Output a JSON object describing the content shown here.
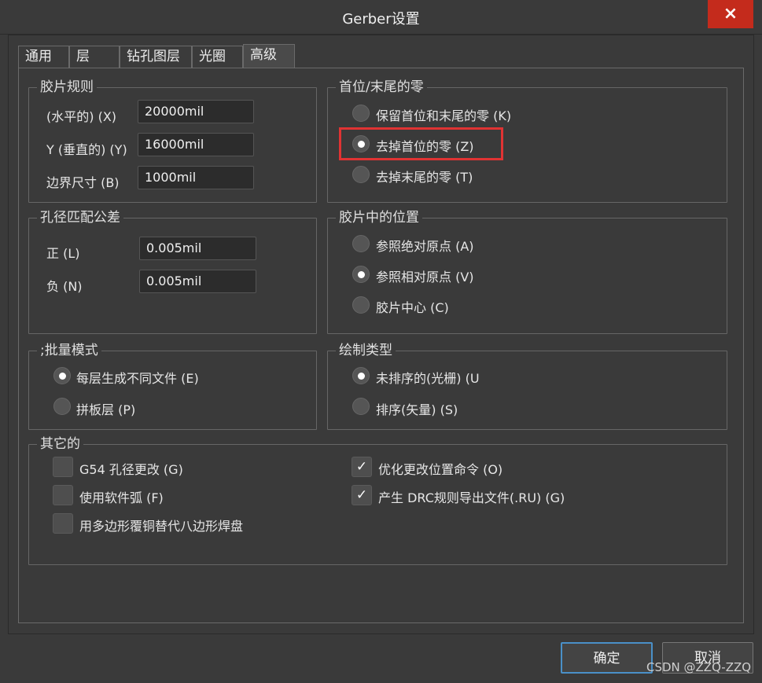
{
  "window": {
    "title": "Gerber设置",
    "close_icon": "×"
  },
  "tabs": [
    {
      "label": "通用"
    },
    {
      "label": "层"
    },
    {
      "label": "钻孔图层"
    },
    {
      "label": "光圈"
    },
    {
      "label": "高级"
    }
  ],
  "film_rules": {
    "title": "胶片规则",
    "rows": [
      {
        "label": "(水平的) (X)",
        "value": "20000mil"
      },
      {
        "label": "Y (垂直的) (Y)",
        "value": "16000mil"
      },
      {
        "label": "边界尺寸 (B)",
        "value": "1000mil"
      }
    ]
  },
  "zeros": {
    "title": "首位/末尾的零",
    "options": [
      {
        "label": "保留首位和末尾的零 (K)",
        "checked": false
      },
      {
        "label": "去掉首位的零 (Z)",
        "checked": true
      },
      {
        "label": "去掉末尾的零 (T)",
        "checked": false
      }
    ]
  },
  "aperture_tolerance": {
    "title": "孔径匹配公差",
    "rows": [
      {
        "label": "正 (L)",
        "value": "0.005mil"
      },
      {
        "label": "负 (N)",
        "value": "0.005mil"
      }
    ]
  },
  "film_position": {
    "title": "胶片中的位置",
    "options": [
      {
        "label": "参照绝对原点 (A)",
        "checked": false
      },
      {
        "label": "参照相对原点 (V)",
        "checked": true
      },
      {
        "label": "胶片中心 (C)",
        "checked": false
      }
    ]
  },
  "batch_mode": {
    "title": ";批量模式",
    "options": [
      {
        "label": "每层生成不同文件 (E)",
        "checked": true
      },
      {
        "label": "拼板层 (P)",
        "checked": false
      }
    ]
  },
  "plot_type": {
    "title": "绘制类型",
    "options": [
      {
        "label": "未排序的(光栅) (U",
        "checked": true
      },
      {
        "label": "排序(矢量) (S)",
        "checked": false
      }
    ]
  },
  "other": {
    "title": "其它的",
    "checks": [
      {
        "label": "G54 孔径更改 (G)",
        "checked": false
      },
      {
        "label": "使用软件弧 (F)",
        "checked": false
      },
      {
        "label": "用多边形覆铜替代八边形焊盘",
        "checked": false
      },
      {
        "label": "优化更改位置命令 (O)",
        "checked": true
      },
      {
        "label": "产生 DRC规则导出文件(.RU) (G)",
        "checked": true
      }
    ],
    "check_glyph": "✓"
  },
  "footer": {
    "ok_label": "确定",
    "cancel_label": "取消"
  },
  "watermark": "CSDN @ZZQ-ZZQ"
}
